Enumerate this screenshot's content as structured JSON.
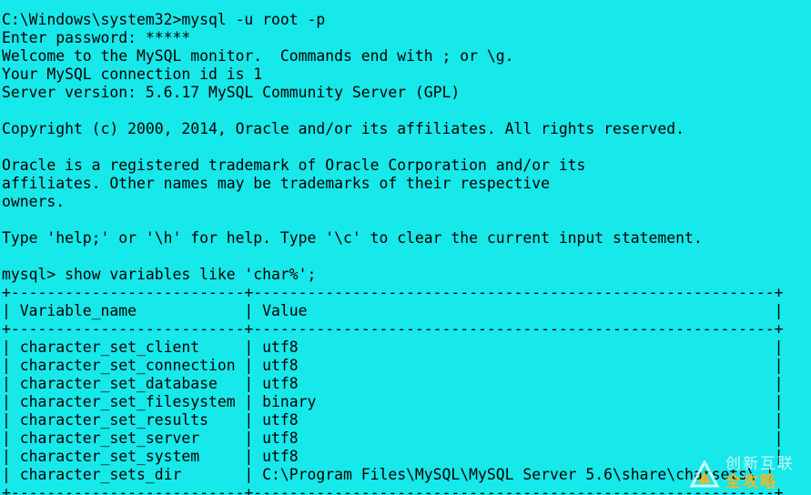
{
  "colors": {
    "background": "#17e8ea",
    "text": "#000000",
    "watermark_accent": "#f5b623"
  },
  "terminal": {
    "lines": [
      "C:\\Windows\\system32>mysql -u root -p",
      "Enter password: *****",
      "Welcome to the MySQL monitor.  Commands end with ; or \\g.",
      "Your MySQL connection id is 1",
      "Server version: 5.6.17 MySQL Community Server (GPL)",
      "",
      "Copyright (c) 2000, 2014, Oracle and/or its affiliates. All rights reserved.",
      "",
      "Oracle is a registered trademark of Oracle Corporation and/or its",
      "affiliates. Other names may be trademarks of their respective",
      "owners.",
      "",
      "Type 'help;' or '\\h' for help. Type '\\c' to clear the current input statement.",
      "",
      "mysql> show variables like 'char%';",
      "+--------------------------+----------------------------------------------------------+",
      "| Variable_name            | Value                                                    |",
      "+--------------------------+----------------------------------------------------------+",
      "| character_set_client     | utf8                                                     |",
      "| character_set_connection | utf8                                                     |",
      "| character_set_database   | utf8                                                     |",
      "| character_set_filesystem | binary                                                   |",
      "| character_set_results    | utf8                                                     |",
      "| character_set_server     | utf8                                                     |",
      "| character_set_system     | utf8                                                     |",
      "| character_sets_dir       | C:\\Program Files\\MySQL\\MySQL Server 5.6\\share\\charsets\\ |",
      "+--------------------------+----------------------------------------------------------+"
    ]
  },
  "watermark": {
    "icon": "logo-icon",
    "top_text": "创新互联",
    "bottom_text": "全攻略"
  }
}
